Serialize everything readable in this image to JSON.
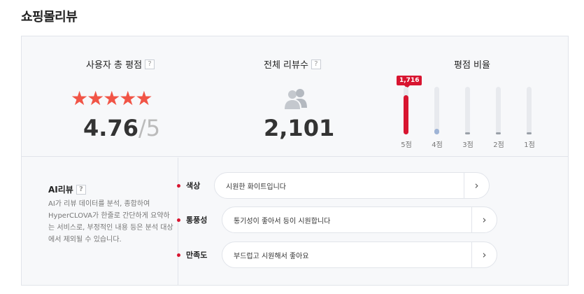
{
  "title": "쇼핑몰리뷰",
  "stats": {
    "rating_label": "사용자 총 평점",
    "total_label": "전체 리뷰수",
    "ratio_label": "평점 비율",
    "help": "?",
    "stars": "★★★★★",
    "score": "4.76",
    "score_max": "/5",
    "total_reviews": "2,101",
    "ratio_badge": "1,716",
    "ratios": [
      {
        "label": "5점",
        "fraction": 0.82,
        "color": "#d81530"
      },
      {
        "label": "4점",
        "fraction": 0.12,
        "color": "#9fb4d6"
      },
      {
        "label": "3점",
        "fraction": 0.02,
        "color": "#9aa0a8"
      },
      {
        "label": "2점",
        "fraction": 0.01,
        "color": "#9aa0a8"
      },
      {
        "label": "1점",
        "fraction": 0.01,
        "color": "#9aa0a8"
      }
    ]
  },
  "ai": {
    "title": "AI리뷰",
    "help": "?",
    "description": "AI가 리뷰 데이터를 분석, 종합하여 HyperCLOVA가 한줄로 간단하게 요약하는 서비스로, 부정적인 내용 등은 분석 대상에서 제외될 수 있습니다.",
    "items": [
      {
        "key": "색상",
        "summary": "시원한 화이트입니다"
      },
      {
        "key": "통풍성",
        "summary": "통기성이 좋아서 등이 시원합니다"
      },
      {
        "key": "만족도",
        "summary": "부드럽고 시원해서 좋아요"
      }
    ],
    "arrow": "›"
  },
  "colors": {
    "accent": "#d81530",
    "star": "#f15446"
  }
}
